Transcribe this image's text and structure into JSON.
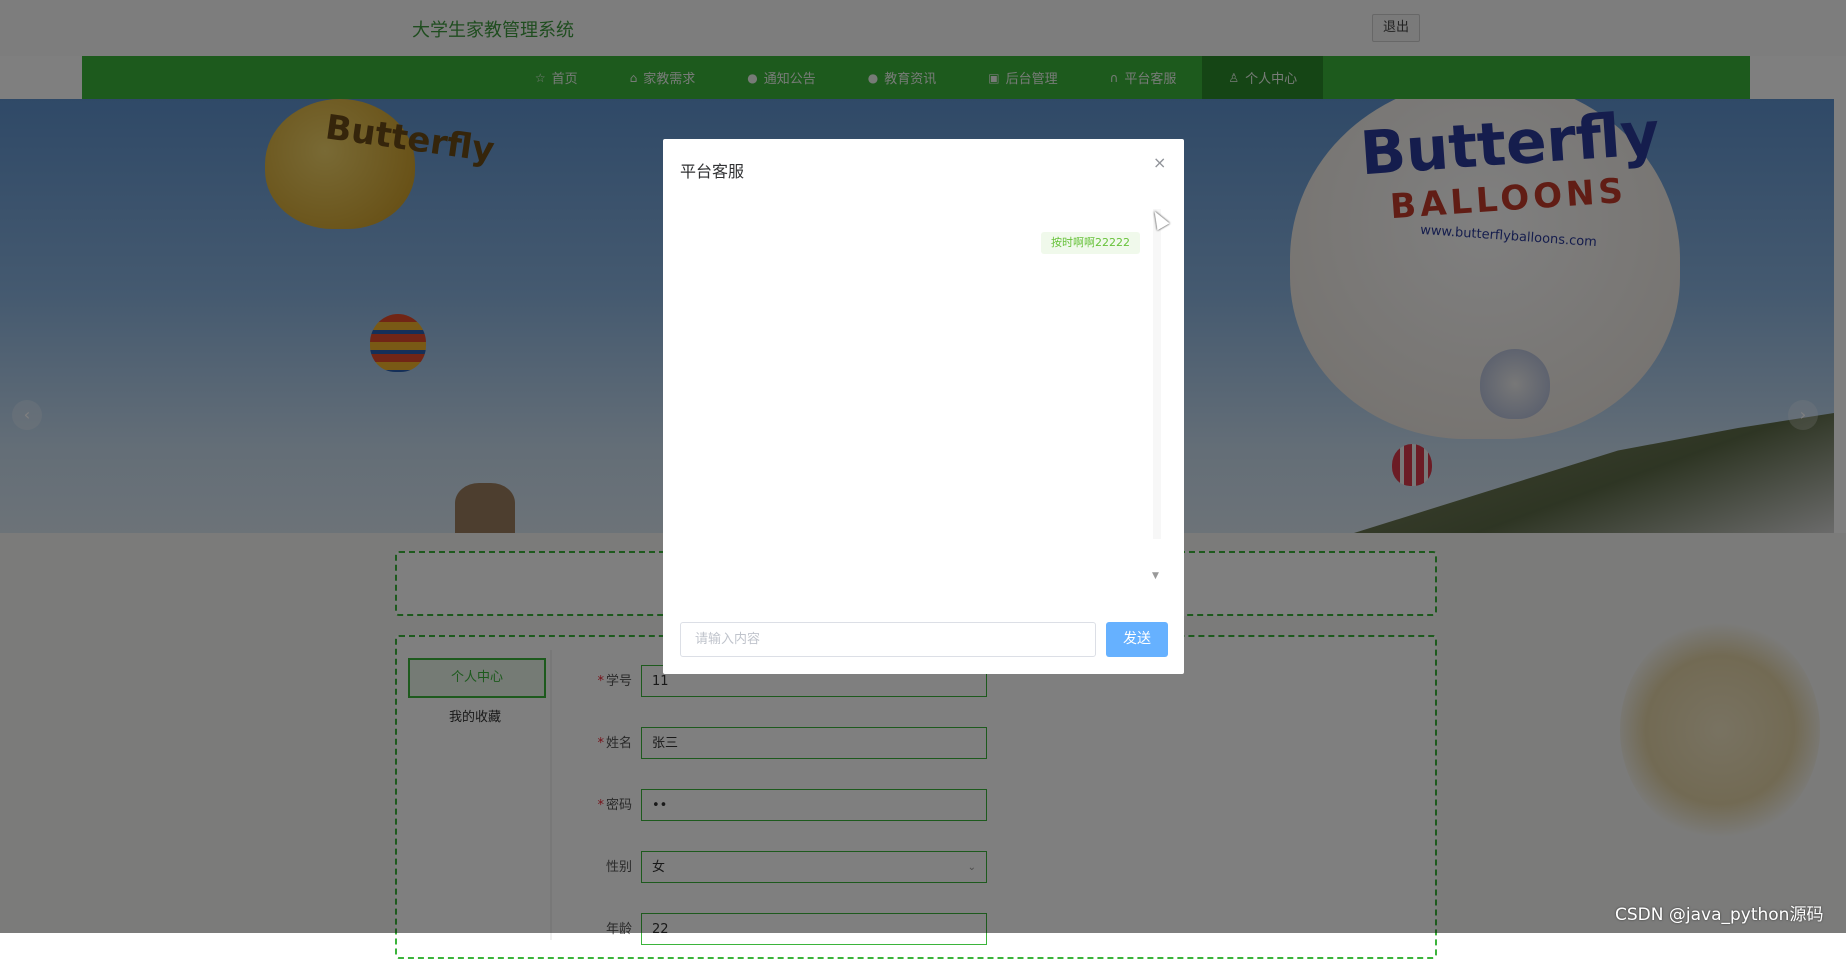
{
  "header": {
    "title": "大学生家教管理系统",
    "logout_label": "退出"
  },
  "nav": {
    "items": [
      {
        "label": "首页",
        "icon": "star-icon"
      },
      {
        "label": "家教需求",
        "icon": "bag-icon"
      },
      {
        "label": "通知公告",
        "icon": "dot-icon"
      },
      {
        "label": "教育资讯",
        "icon": "dot-icon"
      },
      {
        "label": "后台管理",
        "icon": "briefcase-icon"
      },
      {
        "label": "平台客服",
        "icon": "headset-icon"
      },
      {
        "label": "个人中心",
        "icon": "user-icon",
        "active": true
      }
    ]
  },
  "carousel": {
    "texts": [
      "Butterfly",
      "Butterfly",
      "BALLOONS",
      "www.butterflyballoons.com"
    ]
  },
  "profile": {
    "side_tab": "个人中心",
    "side_link": "我的收藏",
    "fields": [
      {
        "label": "学号",
        "required": true,
        "value": "11"
      },
      {
        "label": "姓名",
        "required": true,
        "value": "张三"
      },
      {
        "label": "密码",
        "required": true,
        "value": "••"
      },
      {
        "label": "性别",
        "required": false,
        "value": "女"
      },
      {
        "label": "年龄",
        "required": false,
        "value": "22"
      }
    ]
  },
  "dialog": {
    "title": "平台客服",
    "close_glyph": "×",
    "message": "按时啊啊22222",
    "input_placeholder": "请输入内容",
    "send_label": "发送"
  },
  "watermark": "CSDN @java_python源码"
}
